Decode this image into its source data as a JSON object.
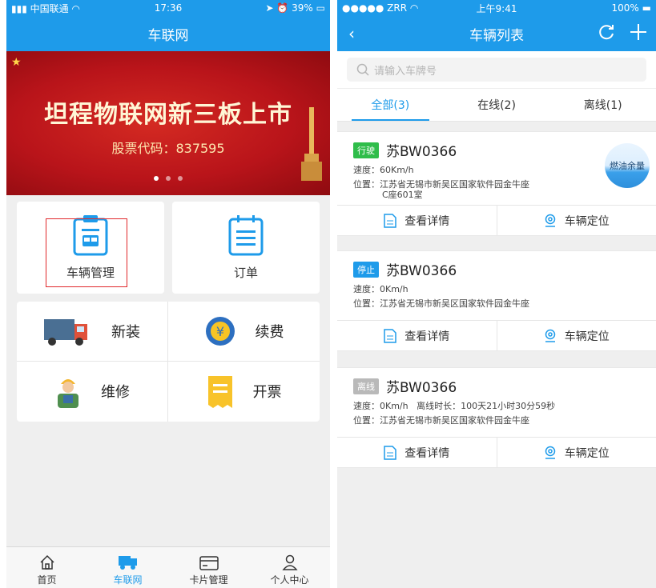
{
  "left": {
    "status": {
      "carrier": "中国联通",
      "time": "17:36",
      "battery": "39%"
    },
    "title": "车联网",
    "banner": {
      "title": "坦程物联网新三板上市",
      "subtitle": "股票代码：837595"
    },
    "cards": [
      {
        "label": "车辆管理"
      },
      {
        "label": "订单"
      }
    ],
    "services": [
      {
        "label": "新装",
        "icon": "truck-icon"
      },
      {
        "label": "续费",
        "icon": "yuan-renew-icon"
      },
      {
        "label": "维修",
        "icon": "worker-icon"
      },
      {
        "label": "开票",
        "icon": "invoice-icon"
      }
    ],
    "tabs": [
      {
        "label": "首页",
        "icon": "home-icon"
      },
      {
        "label": "车联网",
        "icon": "truck-icon"
      },
      {
        "label": "卡片管理",
        "icon": "card-icon"
      },
      {
        "label": "个人中心",
        "icon": "person-icon"
      }
    ],
    "active_tab": "车联网"
  },
  "right": {
    "status": {
      "carrier": "ZRR",
      "time": "上午9:41",
      "battery": "100%"
    },
    "title": "车辆列表",
    "search_placeholder": "请输入车牌号",
    "tabs": [
      {
        "label": "全部(3)"
      },
      {
        "label": "在线(2)"
      },
      {
        "label": "离线(1)"
      }
    ],
    "vehicles": [
      {
        "status": "行驶",
        "status_color": "#2fbd4a",
        "plate": "苏BW0366",
        "speed_label": "速度：",
        "speed": "60Km/h",
        "loc_label": "位置：",
        "location": "江苏省无锡市新吴区国家软件园金牛座",
        "location2": "C座601室",
        "fuel": "燃油余量"
      },
      {
        "status": "停止",
        "status_color": "#1e9bea",
        "plate": "苏BW0366",
        "speed_label": "速度：",
        "speed": "0Km/h",
        "loc_label": "位置：",
        "location": "江苏省无锡市新吴区国家软件园金牛座"
      },
      {
        "status": "离线",
        "status_color": "#b9b9b9",
        "plate": "苏BW0366",
        "speed_label": "速度：",
        "speed": "0Km/h",
        "offline_label": "离线时长：",
        "offline": "100天21小时30分59秒",
        "loc_label": "位置：",
        "location": "江苏省无锡市新吴区国家软件园金牛座"
      }
    ],
    "actions": {
      "detail": "查看详情",
      "locate": "车辆定位"
    }
  },
  "colors": {
    "primary": "#1e9bea",
    "highlight": "#e0282b"
  }
}
